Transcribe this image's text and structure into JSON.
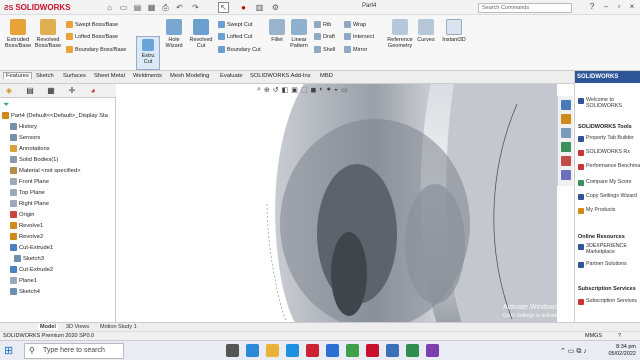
{
  "app": {
    "logo": "SOLIDWORKS",
    "doc_title": "Part4",
    "search_placeholder": "Search Commands"
  },
  "ribbon": {
    "extruded_boss": "Extruded Boss/Base",
    "revolved_boss": "Revolved Boss/Base",
    "swept_boss": "Swept Boss/Base",
    "lofted_boss": "Lofted Boss/Base",
    "boundary_boss": "Boundary Boss/Base",
    "extruded_cut": "Extru Cut",
    "hole_wizard": "Hole Wizard",
    "revolved_cut": "Revolved Cut",
    "swept_cut": "Swept Cut",
    "lofted_cut": "Lofted Cut",
    "boundary_cut": "Boundary Cut",
    "fillet": "Fillet",
    "linear_pattern": "Linear Pattern",
    "rib": "Rib",
    "draft": "Draft",
    "shell": "Shell",
    "wrap": "Wrap",
    "intersect": "Intersect",
    "mirror": "Mirror",
    "reference_geometry": "Reference Geometry",
    "curves": "Curves",
    "instant3d": "Instant3D"
  },
  "tabs": [
    "Features",
    "Sketch",
    "Surfaces",
    "Sheet Metal",
    "Weldments",
    "Mesh Modeling",
    "Evaluate",
    "SOLIDWORKS Add-Ins",
    "MBD"
  ],
  "tree": {
    "root": "Part4  (Default<<Default>_Display Sta",
    "items": [
      "History",
      "Sensors",
      "Annotations",
      "Solid Bodies(1)",
      "Material <not specified>",
      "Front Plane",
      "Top Plane",
      "Right Plane",
      "Origin",
      "Revolve1",
      "Revolve2",
      "Cut-Extrude1",
      "Sketch3",
      "Cut-Extrude2",
      "Plane1",
      "Sketch4"
    ]
  },
  "taskpane": {
    "header": "SOLIDWORKS",
    "welcome": "Welcome to SOLIDWORKS",
    "tools_title": "SOLIDWORKS Tools",
    "tools": [
      "Property Tab Builder",
      "SOLIDWORKS Rx",
      "Performance Benchmark Test",
      "Compare My Score",
      "Copy Settings Wizard",
      "My Products"
    ],
    "online_title": "Online Resources",
    "online": [
      "3DEXPERIENCE Marketplace",
      "Partner Solutions"
    ],
    "sub_title": "Subscription Services",
    "sub": [
      "Subscription Services"
    ]
  },
  "bottom_tabs": [
    "Model",
    "3D Views",
    "Motion Study 1"
  ],
  "status": {
    "left": "SOLIDWORKS Premium 2020 SP0.0",
    "units": "MMGS"
  },
  "taskbar": {
    "search": "Type here to search",
    "time": "8:34 pm",
    "date": "05/02/2022"
  },
  "watermark": {
    "line1": "Activate Windows",
    "line2": "Go to Settings to activate Windows."
  }
}
